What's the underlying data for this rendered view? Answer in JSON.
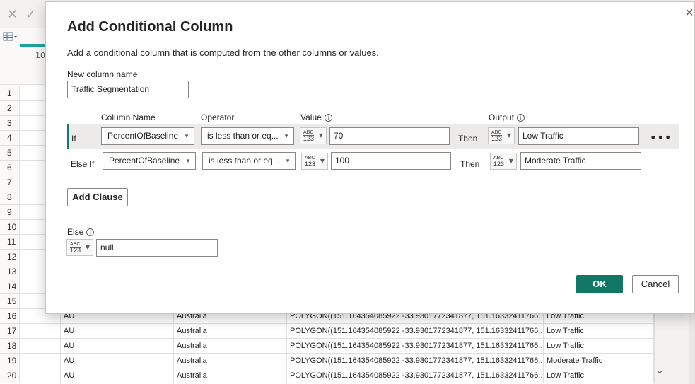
{
  "toolbar": {
    "cancel_icon": "close-icon",
    "check_icon": "check-icon"
  },
  "background": {
    "column_hint": "10",
    "row_numbers": [
      "1",
      "2",
      "3",
      "4",
      "5",
      "6",
      "7",
      "8",
      "9",
      "10",
      "11",
      "12",
      "13",
      "14",
      "15"
    ],
    "data_rows": [
      {
        "num": "16",
        "country": "AU",
        "name": "Australia",
        "geo": "POLYGON((151.164354085922 -33.9301772341877, 151.16332411766...",
        "segment": "Low Traffic"
      },
      {
        "num": "17",
        "country": "AU",
        "name": "Australia",
        "geo": "POLYGON((151.164354085922 -33.9301772341877, 151.16332411766...",
        "segment": "Low Traffic"
      },
      {
        "num": "18",
        "country": "AU",
        "name": "Australia",
        "geo": "POLYGON((151.164354085922 -33.9301772341877, 151.16332411766...",
        "segment": "Low Traffic"
      },
      {
        "num": "19",
        "country": "AU",
        "name": "Australia",
        "geo": "POLYGON((151.164354085922 -33.9301772341877, 151.16332411766...",
        "segment": "Moderate Traffic"
      },
      {
        "num": "20",
        "country": "AU",
        "name": "Australia",
        "geo": "POLYGON((151.164354085922 -33.9301772341877, 151.16332411766...",
        "segment": "Low Traffic"
      }
    ]
  },
  "dialog": {
    "title": "Add Conditional Column",
    "description": "Add a conditional column that is computed from the other columns or values.",
    "new_column_label": "New column name",
    "new_column_value": "Traffic Segmentation",
    "headers": {
      "column_name": "Column Name",
      "operator": "Operator",
      "value": "Value",
      "output": "Output"
    },
    "info_glyph": "i",
    "then_label": "Then",
    "type_abc": "ABC",
    "type_123": "123",
    "clauses": [
      {
        "label": "If",
        "column": "PercentOfBaseline",
        "operator": "is less than or eq...",
        "value": "70",
        "output": "Low Traffic"
      },
      {
        "label": "Else If",
        "column": "PercentOfBaseline",
        "operator": "is less than or eq...",
        "value": "100",
        "output": "Moderate Traffic"
      }
    ],
    "more_options": "•••",
    "add_clause": "Add Clause",
    "else_label": "Else",
    "else_value": "null",
    "ok": "OK",
    "cancel": "Cancel",
    "close_glyph": "✕"
  },
  "colors": {
    "accent": "#117865",
    "row_highlight": "#edebe9",
    "teal": "#1aa3a3"
  }
}
